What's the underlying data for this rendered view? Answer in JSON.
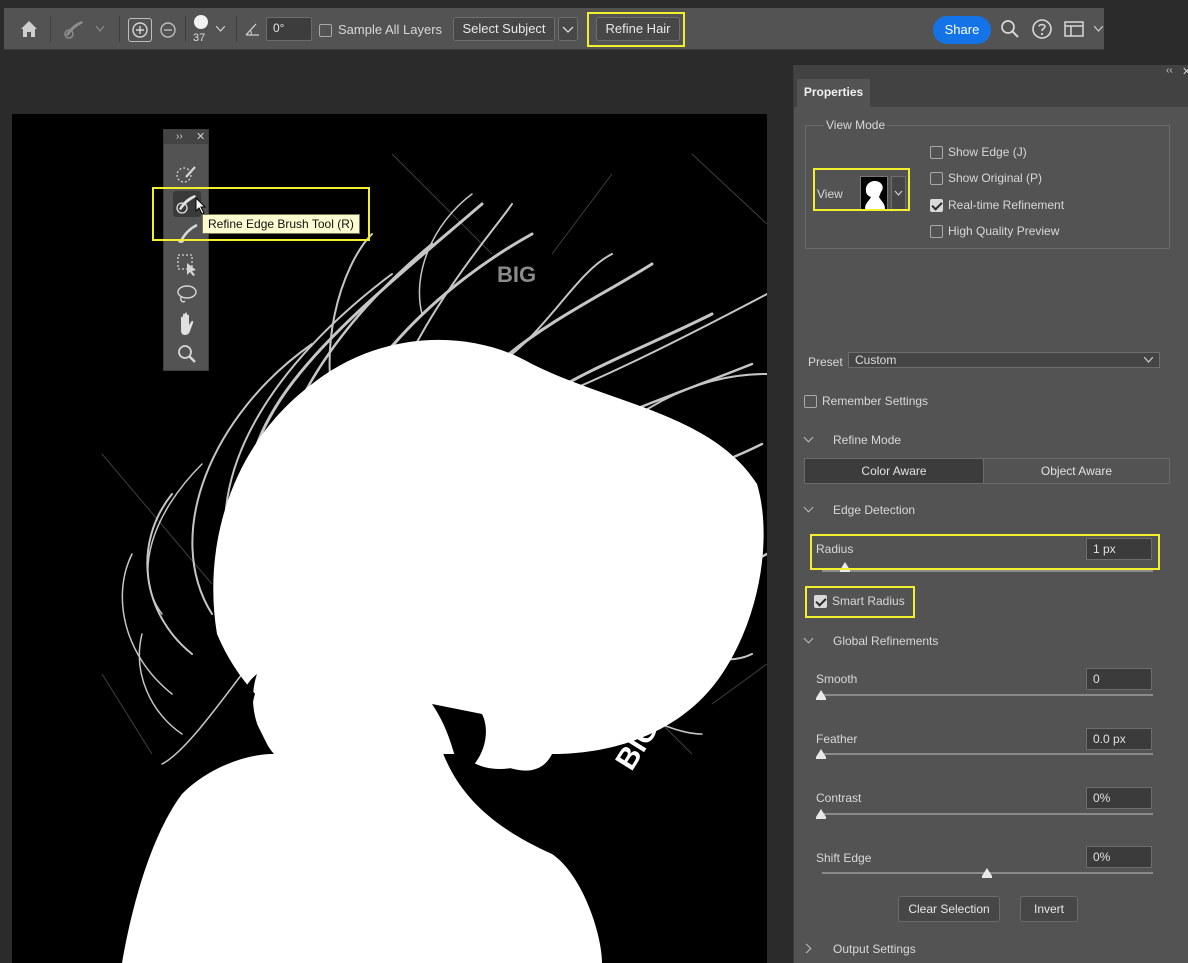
{
  "options_bar": {
    "brush_size": "37",
    "angle_value": "0°",
    "sample_all_layers_label": "Sample All Layers",
    "sample_all_layers_checked": false,
    "select_subject_label": "Select Subject",
    "refine_hair_label": "Refine Hair",
    "share_label": "Share"
  },
  "canvas": {
    "watermark_big": "BIGSTOCK",
    "watermark_small": "BIG"
  },
  "tool_panel": {
    "tooltip": "Refine Edge Brush Tool (R)"
  },
  "properties": {
    "tab_label": "Properties",
    "view_mode": {
      "title": "View Mode",
      "view_label": "View",
      "show_edge_label": "Show Edge (J)",
      "show_edge_checked": false,
      "show_original_label": "Show Original (P)",
      "show_original_checked": false,
      "realtime_label": "Real-time Refinement",
      "realtime_checked": true,
      "hq_preview_label": "High Quality Preview",
      "hq_preview_checked": false
    },
    "preset_label": "Preset",
    "preset_value": "Custom",
    "remember_settings_label": "Remember Settings",
    "remember_settings_checked": false,
    "refine_mode": {
      "title": "Refine Mode",
      "color_aware_label": "Color Aware",
      "object_aware_label": "Object Aware"
    },
    "edge_detection": {
      "title": "Edge Detection",
      "radius_label": "Radius",
      "radius_value": "1 px",
      "radius_level": 0.07,
      "smart_radius_label": "Smart Radius",
      "smart_radius_checked": true
    },
    "global_refinements": {
      "title": "Global Refinements",
      "smooth_label": "Smooth",
      "smooth_value": "0",
      "feather_label": "Feather",
      "feather_value": "0.0 px",
      "contrast_label": "Contrast",
      "contrast_value": "0%",
      "shift_edge_label": "Shift Edge",
      "shift_edge_value": "0%"
    },
    "clear_selection_label": "Clear Selection",
    "invert_label": "Invert",
    "output_settings_label": "Output Settings"
  },
  "colors": {
    "highlight": "#f1ef2e",
    "share_blue": "#1473e6",
    "panel_bg": "#535353",
    "canvas_bg": "#000000",
    "tooltip_bg": "#fcfcd0"
  }
}
